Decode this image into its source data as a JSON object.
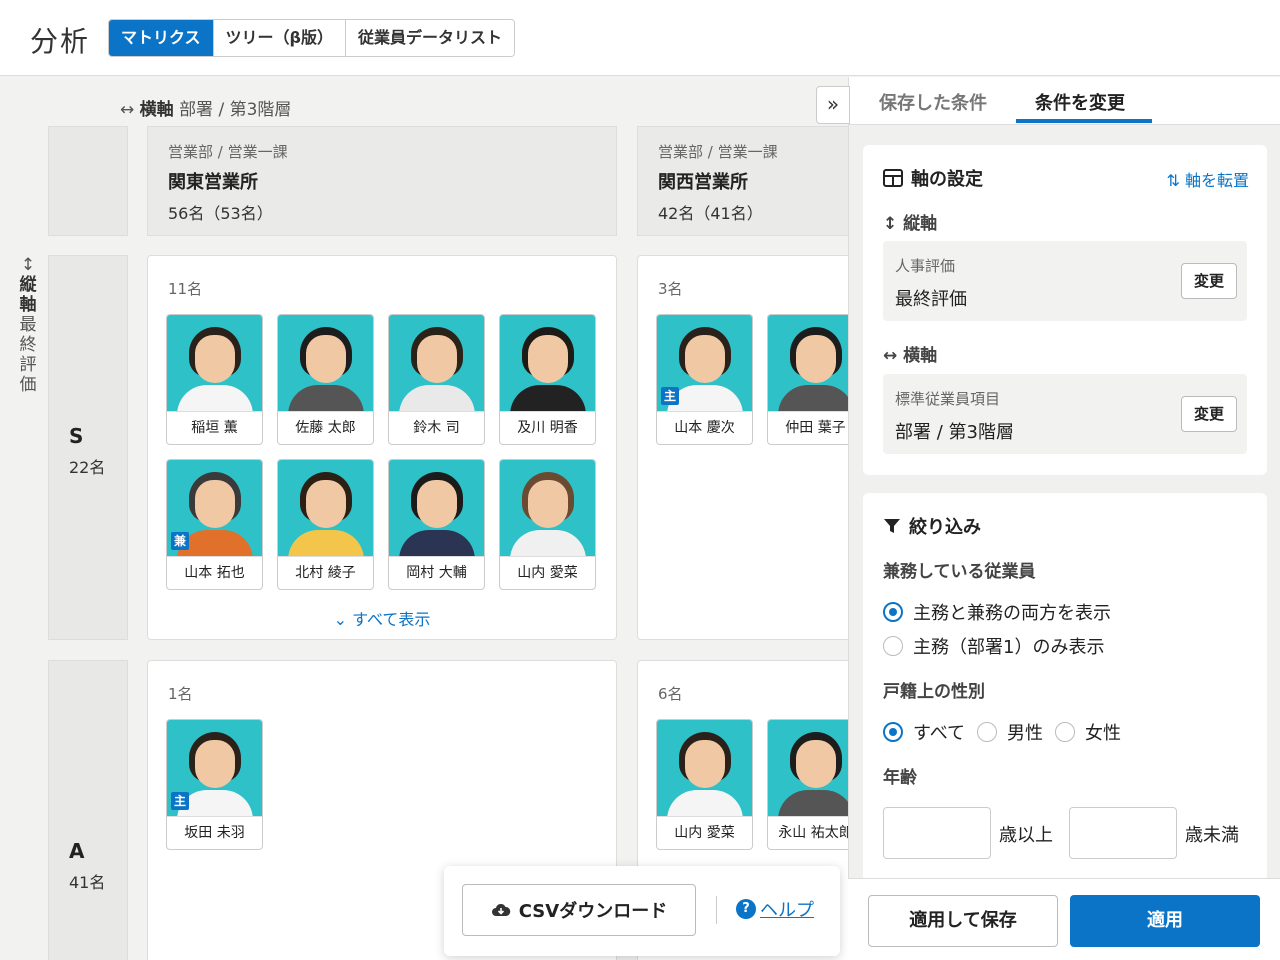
{
  "app": {
    "title": "分析"
  },
  "tabs": [
    {
      "label": "マトリクス",
      "active": true
    },
    {
      "label": "ツリー（β版）",
      "active": false
    },
    {
      "label": "従業員データリスト",
      "active": false
    }
  ],
  "matrix": {
    "h_axis": {
      "icon": "horizontal-arrows-icon",
      "label": "横軸",
      "value": "部署 / 第3階層"
    },
    "v_axis": {
      "icon": "vertical-arrows-icon",
      "label": "縦軸",
      "value": "最終評価"
    },
    "columns": [
      {
        "path": "営業部 / 営業一課",
        "name": "関東営業所",
        "count": "56名（53名）"
      },
      {
        "path": "営業部 / 営業一課",
        "name": "関西営業所",
        "count": "42名（41名）"
      }
    ],
    "rows": [
      {
        "grade": "S",
        "count": "22名"
      },
      {
        "grade": "A",
        "count": "41名"
      }
    ],
    "cells": {
      "s_kanto": {
        "count": "11名",
        "people": [
          {
            "name": "稲垣 薫",
            "badge": ""
          },
          {
            "name": "佐藤 太郎",
            "badge": ""
          },
          {
            "name": "鈴木 司",
            "badge": ""
          },
          {
            "name": "及川 明香",
            "badge": ""
          },
          {
            "name": "山本 拓也",
            "badge": "兼"
          },
          {
            "name": "北村 綾子",
            "badge": ""
          },
          {
            "name": "岡村 大輔",
            "badge": ""
          },
          {
            "name": "山内 愛菜",
            "badge": ""
          }
        ],
        "show_all": "すべて表示"
      },
      "s_kansai": {
        "count": "3名",
        "people": [
          {
            "name": "山本 慶次",
            "badge": "主"
          },
          {
            "name": "仲田 葉子",
            "badge": ""
          }
        ]
      },
      "a_kanto": {
        "count": "1名",
        "people": [
          {
            "name": "坂田 未羽",
            "badge": "主"
          }
        ]
      },
      "a_kansai": {
        "count": "6名",
        "people": [
          {
            "name": "山内 愛菜",
            "badge": ""
          },
          {
            "name": "永山 祐太郎",
            "badge": ""
          }
        ]
      }
    }
  },
  "float_bar": {
    "csv_label": "CSVダウンロード",
    "help_label": "ヘルプ"
  },
  "panel": {
    "tabs": [
      {
        "label": "保存した条件",
        "active": false
      },
      {
        "label": "条件を変更",
        "active": true
      }
    ],
    "axis_settings": {
      "title": "軸の設定",
      "transpose_label": "軸を転置",
      "vertical_label": "縦軸",
      "vertical_key": "人事評価",
      "vertical_value": "最終評価",
      "horizontal_label": "横軸",
      "horizontal_key": "標準従業員項目",
      "horizontal_value": "部署 / 第3階層",
      "change_label": "変更"
    },
    "filter": {
      "title": "絞り込み",
      "concurrent_label": "兼務している従業員",
      "concurrent_options": [
        {
          "label": "主務と兼務の両方を表示",
          "selected": true
        },
        {
          "label": "主務（部署1）のみ表示",
          "selected": false
        }
      ],
      "gender_label": "戸籍上の性別",
      "gender_options": [
        {
          "label": "すべて",
          "selected": true
        },
        {
          "label": "男性",
          "selected": false
        },
        {
          "label": "女性",
          "selected": false
        }
      ],
      "age_label": "年齢",
      "age_min_value": "",
      "age_min_suffix": "歳以上",
      "age_max_value": "",
      "age_max_suffix": "歳未満"
    },
    "footer": {
      "save_apply_label": "適用して保存",
      "apply_label": "適用"
    }
  },
  "colors": {
    "accent": "#0b74c7",
    "photo_bg": "#2ec1c8"
  }
}
